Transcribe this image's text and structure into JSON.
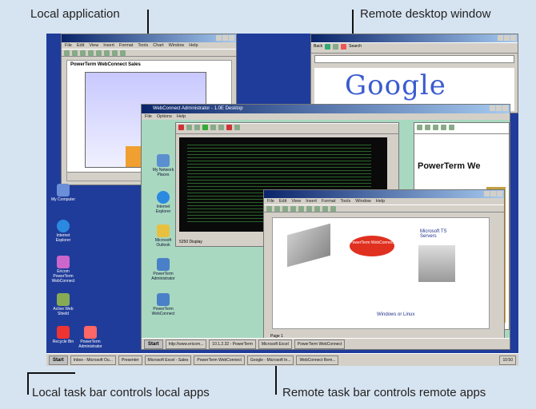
{
  "callouts": {
    "local_app": "Local application",
    "remote_window": "Remote desktop window",
    "local_taskbar": "Local task bar controls local apps",
    "remote_taskbar": "Remote task bar controls remote apps"
  },
  "local_excel": {
    "menu": [
      "File",
      "Edit",
      "View",
      "Insert",
      "Format",
      "Tools",
      "Chart",
      "Window",
      "Help"
    ],
    "chart_title": "PowerTerm WebConnect Sales"
  },
  "browser": {
    "menu": [
      "Back",
      "Search"
    ],
    "logo": "Google"
  },
  "remote": {
    "title": "WebConnect Administrator - 1.0E Desktop",
    "menu": [
      "File",
      "Options",
      "Help"
    ],
    "side_text": "PowerTerm We",
    "terminal_tab": "5250 Display",
    "desktop_icons": [
      "My Network Places",
      "Internet Explorer",
      "Microsoft Outlook",
      "PowerTerm Administrator",
      "PowerTerm WebConnect"
    ],
    "diagram": {
      "menu": [
        "File",
        "Edit",
        "View",
        "Insert",
        "Format",
        "Tools",
        "Window",
        "Help"
      ],
      "bubble": "PowerTerm WebConnect",
      "server_label": "Microsoft TS Servers",
      "os_label": "Windows or Linux",
      "page": "Page 1"
    },
    "taskbar": {
      "start": "Start",
      "items": [
        "http://www.ericom...",
        "10.1.2.32 - PowerTerm",
        "Microsoft Excel",
        "PowerTerm WebConnect"
      ]
    }
  },
  "local_desktop_icons": [
    "My Computer",
    "Internet Explorer",
    "Ericom PowerTerm WebConnect",
    "Active Web Shield",
    "Recycle Bin",
    "PowerTerm Administrator"
  ],
  "local_taskbar": {
    "start": "Start",
    "items": [
      "Inbox - Microsoft Ou...",
      "Presenter",
      "Microsoft Excel - Sales",
      "PowerTerm WebConnect",
      "Google - Microsoft In...",
      "WebConnect Rem..."
    ],
    "clock": "10:50"
  }
}
